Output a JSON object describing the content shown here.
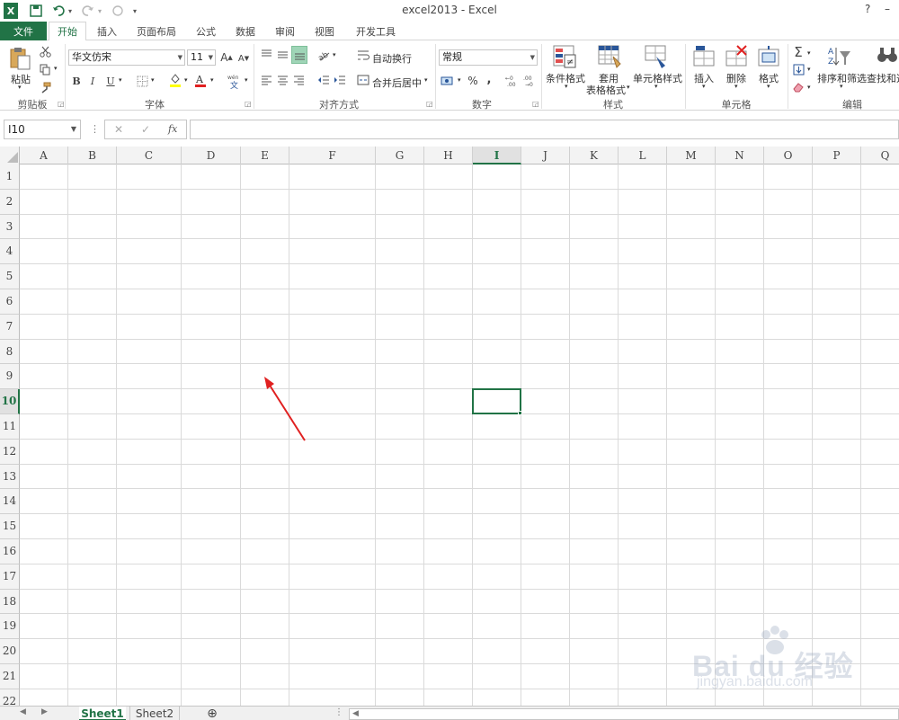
{
  "window": {
    "title": "excel2013 - Excel",
    "help": "?",
    "min": "–",
    "restore": "❐"
  },
  "quick_access": {
    "logo": "X",
    "undo_arrow": "▾",
    "redo_arrow": "▾",
    "customize": "▾"
  },
  "tabs": {
    "file": "文件",
    "items": [
      "开始",
      "插入",
      "页面布局",
      "公式",
      "数据",
      "审阅",
      "视图",
      "开发工具"
    ]
  },
  "ribbon": {
    "clipboard": {
      "paste": "粘贴",
      "label": "剪贴板"
    },
    "font": {
      "name": "华文仿宋",
      "size": "11",
      "grow": "A",
      "shrink": "A",
      "bold": "B",
      "italic": "I",
      "underline": "U",
      "label": "字体"
    },
    "alignment": {
      "wrap": "自动换行",
      "merge": "合并后居中",
      "label": "对齐方式"
    },
    "number": {
      "format": "常规",
      "percent": "%",
      "comma": ",",
      "label": "数字"
    },
    "styles": {
      "conditional": "条件格式",
      "table_1": "套用",
      "table_2": "表格格式",
      "cell_styles": "单元格样式",
      "label": "样式"
    },
    "cells": {
      "insert": "插入",
      "delete": "删除",
      "format": "格式",
      "label": "单元格"
    },
    "editing": {
      "sigma": "Σ",
      "sort": "排序和筛选",
      "find": "查找和选",
      "label": "编辑"
    }
  },
  "formula_bar": {
    "name_box": "I10",
    "more": "⋮",
    "cancel": "✕",
    "enter": "✓",
    "fx": "fx",
    "value": ""
  },
  "grid": {
    "columns": [
      "A",
      "B",
      "C",
      "D",
      "E",
      "F",
      "G",
      "H",
      "I",
      "J",
      "K",
      "L",
      "M",
      "N",
      "O",
      "P",
      "Q"
    ],
    "rows": [
      "1",
      "2",
      "3",
      "4",
      "5",
      "6",
      "7",
      "8",
      "9",
      "10",
      "11",
      "12",
      "13",
      "14",
      "15",
      "16",
      "17",
      "18",
      "19",
      "20",
      "21",
      "22"
    ],
    "selected_column": "I",
    "selected_row": "10"
  },
  "sheets": {
    "tabs": [
      "Sheet1",
      "Sheet2"
    ],
    "active": "Sheet1",
    "add": "⊕"
  },
  "watermark": {
    "brand": "Bai du 经验",
    "url": "jingyan.baidu.com"
  },
  "colors": {
    "accent": "#217346",
    "annotation_arrow": "#e02020"
  }
}
